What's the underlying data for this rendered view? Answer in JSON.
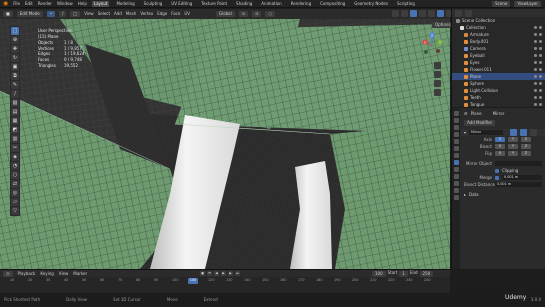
{
  "topbar": {
    "menus": [
      "File",
      "Edit",
      "Render",
      "Window",
      "Help"
    ],
    "workspaces": [
      "Layout",
      "Modeling",
      "Sculpting",
      "UV Editing",
      "Texture Paint",
      "Shading",
      "Animation",
      "Rendering",
      "Compositing",
      "Geometry Nodes",
      "Scripting"
    ],
    "active_workspace": "Layout",
    "scene_label": "Scene",
    "view_layer_label": "ViewLayer"
  },
  "viewport_header": {
    "mode": "Edit Mode",
    "menus": [
      "View",
      "Select",
      "Add",
      "Mesh",
      "Vertex",
      "Edge",
      "Face",
      "UV"
    ],
    "orientation": "Global",
    "options_label": "Options"
  },
  "overlay": {
    "title": "User Perspective",
    "subtitle": "(15) Plane",
    "stats": [
      {
        "key": "Objects",
        "value": "1 / 8"
      },
      {
        "key": "Vertices",
        "value": "1 / 9,857"
      },
      {
        "key": "Edges",
        "value": "1 / 19,624"
      },
      {
        "key": "Faces",
        "value": "0 / 9,748"
      },
      {
        "key": "Triangles",
        "value": "19,552"
      }
    ]
  },
  "gizmo": {
    "axes": [
      "X",
      "Y",
      "Z"
    ]
  },
  "tools": [
    {
      "name": "select-box",
      "glyph": "□"
    },
    {
      "name": "cursor",
      "glyph": "⊕"
    },
    {
      "name": "move",
      "glyph": "✥"
    },
    {
      "name": "rotate",
      "glyph": "↻"
    },
    {
      "name": "scale",
      "glyph": "▣"
    },
    {
      "name": "transform",
      "glyph": "⧉"
    },
    {
      "name": "annotate",
      "glyph": "✎"
    },
    {
      "name": "measure",
      "glyph": "∕"
    },
    {
      "name": "add-cube",
      "glyph": "▧"
    },
    {
      "name": "extrude",
      "glyph": "▤"
    },
    {
      "name": "inset",
      "glyph": "▦"
    },
    {
      "name": "bevel",
      "glyph": "◩"
    },
    {
      "name": "loop-cut",
      "glyph": "▥"
    },
    {
      "name": "knife",
      "glyph": "✂"
    },
    {
      "name": "poly-build",
      "glyph": "◈"
    },
    {
      "name": "spin",
      "glyph": "◔"
    },
    {
      "name": "smooth",
      "glyph": "○"
    },
    {
      "name": "edge-slide",
      "glyph": "⇄"
    },
    {
      "name": "shrink",
      "glyph": "◎"
    },
    {
      "name": "shear",
      "glyph": "▱"
    },
    {
      "name": "rip",
      "glyph": "▽"
    }
  ],
  "timeline": {
    "menus": [
      "Playback",
      "Keying",
      "View",
      "Marker"
    ],
    "current_frame": "100",
    "start_label": "Start",
    "start": "1",
    "end_label": "End",
    "end": "250",
    "ticks": [
      "10",
      "20",
      "30",
      "40",
      "50",
      "60",
      "70",
      "80",
      "90",
      "100",
      "110",
      "120",
      "130",
      "140",
      "150",
      "160",
      "170",
      "180",
      "190",
      "200",
      "210",
      "220",
      "230",
      "240"
    ]
  },
  "statusbar": {
    "items": [
      "Pick Shortest Path",
      "Dolly View",
      "Set 3D Cursor",
      "Move",
      "Extend"
    ],
    "version": "3.0.0"
  },
  "watermark": "Udemy",
  "outliner": {
    "title": "Scene Collection",
    "rows": [
      {
        "label": "Collection",
        "color": "#e0e0e0",
        "selected": false
      },
      {
        "label": "Armature",
        "color": "#d28a3c",
        "selected": false
      },
      {
        "label": "Body.001",
        "color": "#e38f3b",
        "selected": false
      },
      {
        "label": "Camera",
        "color": "#7a8fd0",
        "selected": false
      },
      {
        "label": "Eyeball",
        "color": "#e38f3b",
        "selected": false
      },
      {
        "label": "Eyes",
        "color": "#e38f3b",
        "selected": false
      },
      {
        "label": "Flower.011",
        "color": "#e38f3b",
        "selected": false
      },
      {
        "label": "Plane",
        "color": "#e38f3b",
        "selected": true
      },
      {
        "label": "Sphere",
        "color": "#e38f3b",
        "selected": false
      },
      {
        "label": "Light.Collision",
        "color": "#e38f3b",
        "selected": false
      },
      {
        "label": "Teeth",
        "color": "#e38f3b",
        "selected": false
      },
      {
        "label": "Tongue",
        "color": "#e38f3b",
        "selected": false
      }
    ]
  },
  "properties": {
    "object_name": "Plane",
    "modifier_name": "Mirror",
    "add_modifier": "Add Modifier",
    "mod_label": "Mirror",
    "axis_label": "Axis",
    "bisect_label": "Bisect",
    "flip_label": "Flip",
    "axis_buttons": [
      "X",
      "Y",
      "Z"
    ],
    "mirror_object_label": "Mirror Object",
    "clipping_label": "Clipping",
    "merge_label": "Merge",
    "merge_value": "0.001 m",
    "bisect_distance_label": "Bisect Distance",
    "bisect_distance_value": "0.001 m",
    "data_label": "Data"
  },
  "colors": {
    "accent": "#4772b3",
    "mesh_green": "#6e9a70",
    "mesh_dark": "#2d2d2d",
    "wire": "#1f2b20"
  }
}
